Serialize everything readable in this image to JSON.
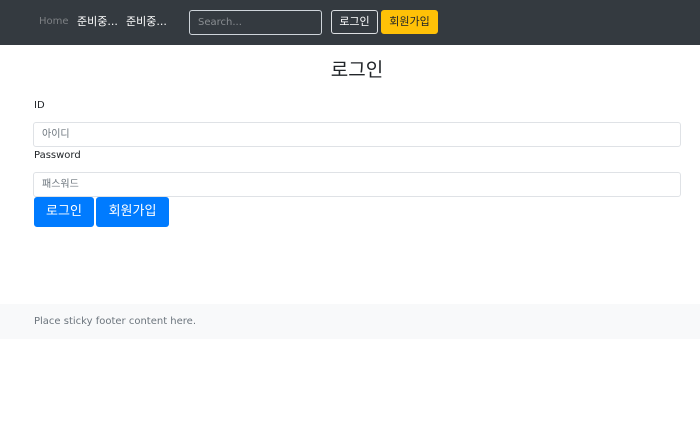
{
  "navbar": {
    "home_label": "Home",
    "item1_label": "준비중...",
    "item2_label": "준비중...",
    "search_placeholder": "Search...",
    "login_label": "로그인",
    "signup_label": "회원가입"
  },
  "main": {
    "title": "로그인",
    "id_label": "ID",
    "id_placeholder": "아이디",
    "password_label": "Password",
    "password_placeholder": "패스워드",
    "login_button": "로그인",
    "signup_button": "회원가입"
  },
  "footer": {
    "text": "Place sticky footer content here."
  },
  "colors": {
    "navbar_bg": "#343a40",
    "primary": "#007bff",
    "warning": "#ffc107",
    "footer_bg": "#f8f9fa"
  }
}
